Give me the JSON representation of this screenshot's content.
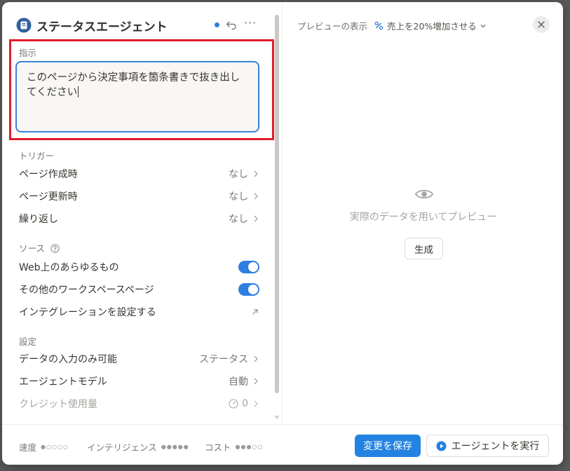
{
  "header": {
    "title": "ステータスエージェント",
    "more": "···"
  },
  "instructions": {
    "label": "指示",
    "text": "このページから決定事項を箇条書きで抜き出してください"
  },
  "triggers": {
    "label": "トリガー",
    "items": [
      {
        "label": "ページ作成時",
        "value": "なし"
      },
      {
        "label": "ページ更新時",
        "value": "なし"
      },
      {
        "label": "繰り返し",
        "value": "なし"
      }
    ]
  },
  "sources": {
    "label": "ソース",
    "items": [
      {
        "label": "Web上のあらゆるもの",
        "enabled": true
      },
      {
        "label": "その他のワークスペースページ",
        "enabled": true
      }
    ],
    "integration_label": "インテグレーションを設定する"
  },
  "settings": {
    "label": "設定",
    "items": [
      {
        "label": "データの入力のみ可能",
        "value": "ステータス"
      },
      {
        "label": "エージェントモデル",
        "value": "自動"
      },
      {
        "label": "クレジット使用量",
        "value": "0"
      }
    ]
  },
  "preview": {
    "label": "プレビューの表示",
    "selector": "売上を20%増加させる",
    "message": "実際のデータを用いてプレビュー",
    "generate": "生成"
  },
  "footer": {
    "speed_label": "速度",
    "intelligence_label": "インテリジェンス",
    "cost_label": "コスト",
    "speed_dots": "●○○○○",
    "intelligence_dots": "●●●●●",
    "cost_dots": "●●●○○",
    "save": "変更を保存",
    "run": "エージェントを実行"
  },
  "colors": {
    "accent": "#2383e2",
    "highlight": "#e01d2a",
    "toggle_on": "#2f7ee0"
  }
}
